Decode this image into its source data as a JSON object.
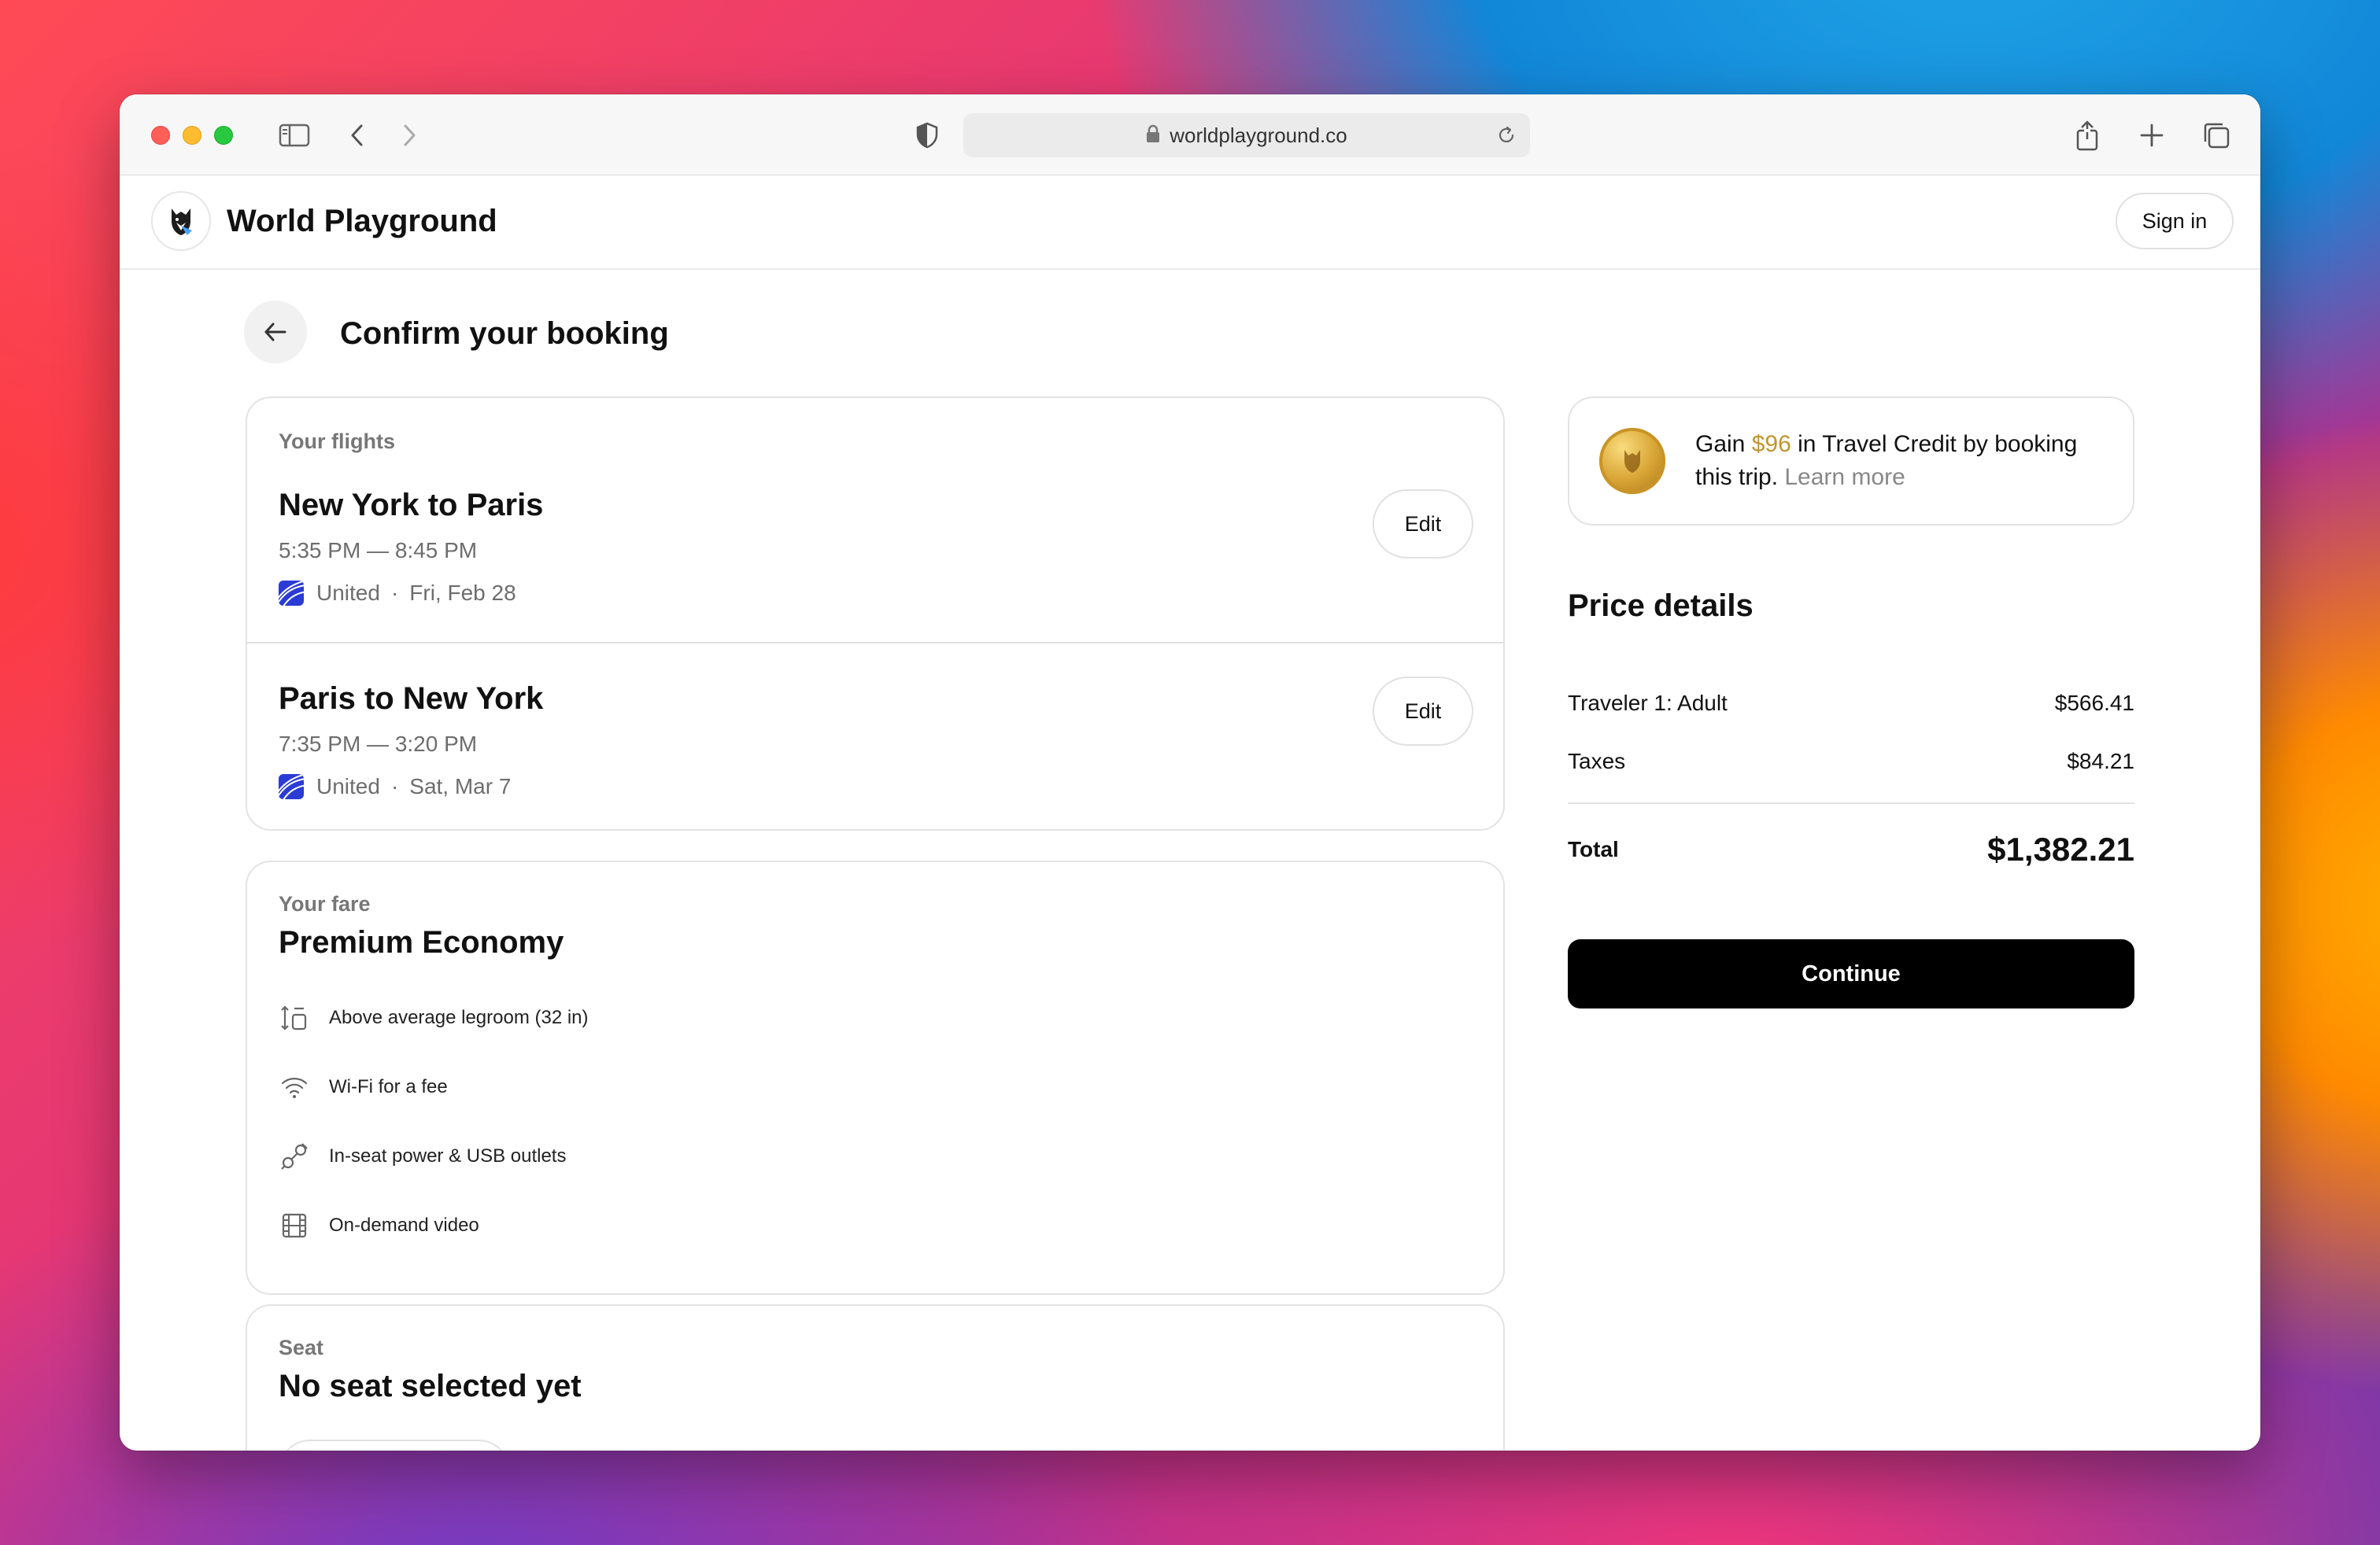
{
  "browser": {
    "url": "worldplayground.co"
  },
  "site": {
    "brand": "World Playground",
    "sign_in": "Sign in"
  },
  "page": {
    "title": "Confirm your booking"
  },
  "flights": {
    "label": "Your flights",
    "items": [
      {
        "route": "New York to Paris",
        "time": "5:35 PM — 8:45 PM",
        "airline": "United",
        "date": "Fri, Feb 28",
        "edit": "Edit"
      },
      {
        "route": "Paris to New York",
        "time": "7:35 PM — 3:20 PM",
        "airline": "United",
        "date": "Sat, Mar 7",
        "edit": "Edit"
      }
    ]
  },
  "fare": {
    "label": "Your fare",
    "name": "Premium Economy",
    "features": [
      {
        "icon": "legroom-icon",
        "text": "Above average legroom (32 in)"
      },
      {
        "icon": "wifi-icon",
        "text": "Wi-Fi for a fee"
      },
      {
        "icon": "power-plug-icon",
        "text": "In-seat power & USB outlets"
      },
      {
        "icon": "film-icon",
        "text": "On-demand video"
      }
    ]
  },
  "seat": {
    "label": "Seat",
    "status": "No seat selected yet"
  },
  "credit": {
    "prefix": "Gain ",
    "amount": "$96",
    "middle": " in Travel Credit by booking this trip. ",
    "learn_more": "Learn more"
  },
  "price": {
    "title": "Price details",
    "rows": [
      {
        "label": "Traveler 1: Adult",
        "amount": "$566.41"
      },
      {
        "label": "Taxes",
        "amount": "$84.21"
      }
    ],
    "total_label": "Total",
    "total_amount": "$1,382.21"
  },
  "cta": {
    "continue": "Continue"
  },
  "colors": {
    "accent_gold": "#c1952e",
    "primary_button": "#000000",
    "airline_brand": "#2b3bd6"
  }
}
